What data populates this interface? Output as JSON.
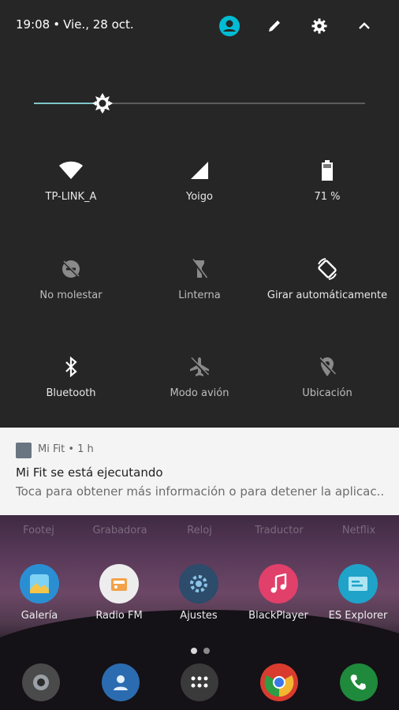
{
  "status_bar": {
    "time": "19:08",
    "date": "Vie., 28 oct."
  },
  "brightness": {
    "level": 0.12
  },
  "tiles": [
    {
      "label": "TP-LINK_A",
      "icon": "wifi-icon",
      "state": "on"
    },
    {
      "label": "Yoigo",
      "icon": "cellular-signal-icon",
      "state": "on"
    },
    {
      "label": "71 %",
      "icon": "battery-icon",
      "state": "on"
    },
    {
      "label": "No molestar",
      "icon": "do-not-disturb-icon",
      "state": "off"
    },
    {
      "label": "Linterna",
      "icon": "flashlight-icon",
      "state": "off"
    },
    {
      "label": "Girar automáticamente",
      "icon": "auto-rotate-icon",
      "state": "on"
    },
    {
      "label": "Bluetooth",
      "icon": "bluetooth-icon",
      "state": "on"
    },
    {
      "label": "Modo avión",
      "icon": "airplane-icon",
      "state": "off"
    },
    {
      "label": "Ubicación",
      "icon": "location-off-icon",
      "state": "off"
    }
  ],
  "notification": {
    "app": "Mi Fit",
    "time_ago": "1 h",
    "title": "Mi Fit se está ejecutando",
    "text": "Toca para obtener más información o para detener la aplicac.."
  },
  "home": {
    "top_row": [
      "Footej",
      "Grabadora",
      "Reloj",
      "Traductor",
      "Netflix"
    ],
    "apps": [
      {
        "name": "Galería",
        "icon": "gallery-icon",
        "color": "#2a8fd2"
      },
      {
        "name": "Radio FM",
        "icon": "radio-icon",
        "color": "#ededed"
      },
      {
        "name": "Ajustes",
        "icon": "settings-app-icon",
        "color": "#2d4b6a"
      },
      {
        "name": "BlackPlayer",
        "icon": "music-icon",
        "color": "#e0406a"
      },
      {
        "name": "ES Explorer",
        "icon": "file-explorer-icon",
        "color": "#1fa3c9"
      }
    ],
    "dock": [
      {
        "icon": "camera-icon",
        "color": "#4a4a4a"
      },
      {
        "icon": "contacts-icon",
        "color": "#2b6cb0"
      },
      {
        "icon": "app-drawer-icon",
        "color": "#3a3a3a"
      },
      {
        "icon": "chrome-icon",
        "color": "#d93c2f"
      },
      {
        "icon": "phone-icon",
        "color": "#1f8a3b"
      }
    ]
  },
  "colors": {
    "accent": "#00bcd4",
    "panel": "#262626"
  }
}
